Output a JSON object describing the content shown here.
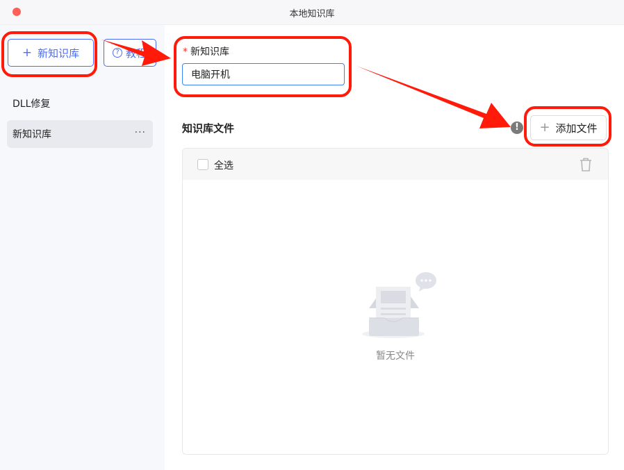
{
  "window": {
    "title": "本地知识库"
  },
  "sidebar": {
    "new_kb_label": "新知识库",
    "tutorial_label": "教程",
    "items": [
      {
        "label": "DLL修复",
        "active": false
      },
      {
        "label": "新知识库",
        "active": true,
        "more": "···"
      }
    ]
  },
  "form": {
    "required_mark": "*",
    "name_label": "新知识库",
    "name_value": "电脑开机"
  },
  "files": {
    "section_title": "知识库文件",
    "add_file_label": "添加文件",
    "select_all_label": "全选",
    "empty_text": "暂无文件"
  },
  "colors": {
    "accent": "#4a6cf7",
    "annotation_red": "#ff1a0a"
  }
}
